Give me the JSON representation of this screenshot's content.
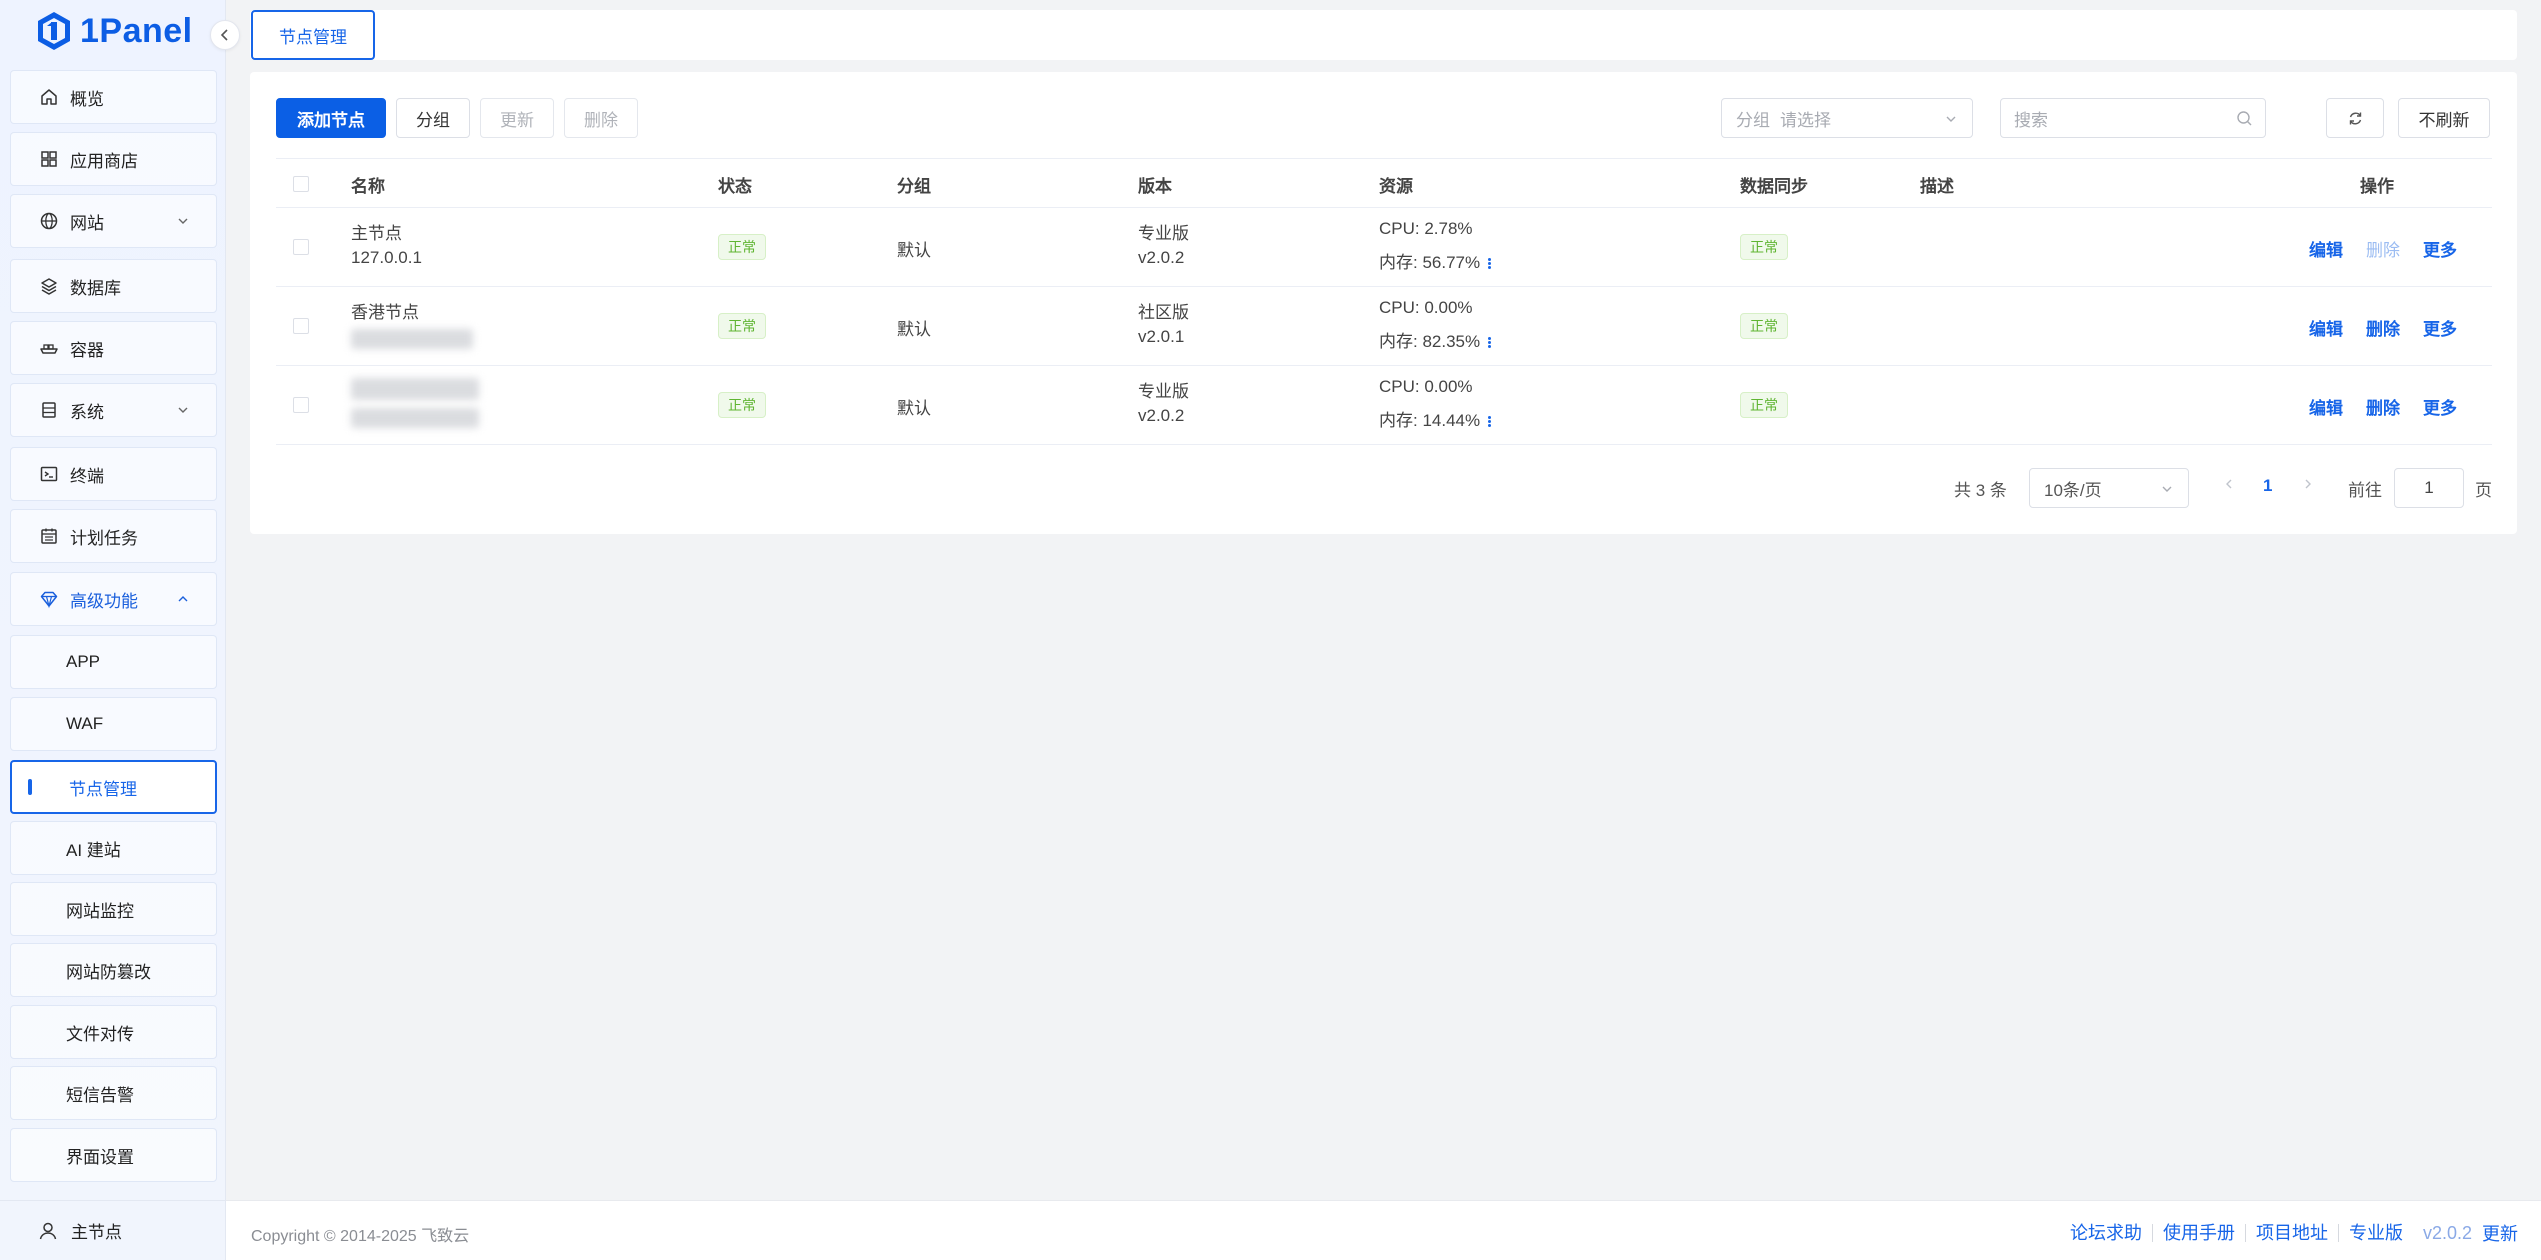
{
  "brand": {
    "name": "1Panel",
    "color": "#0c5de4"
  },
  "sidebar": {
    "items": [
      {
        "label": "概览",
        "icon": "home-icon"
      },
      {
        "label": "应用商店",
        "icon": "apps-grid-icon"
      },
      {
        "label": "网站",
        "icon": "globe-icon"
      },
      {
        "label": "数据库",
        "icon": "layers-icon"
      },
      {
        "label": "容器",
        "icon": "container-ship-icon"
      },
      {
        "label": "系统",
        "icon": "server-icon"
      },
      {
        "label": "终端",
        "icon": "terminal-icon"
      },
      {
        "label": "计划任务",
        "icon": "calendar-icon"
      },
      {
        "label": "高级功能",
        "icon": "diamond-icon"
      }
    ],
    "submenu": [
      {
        "label": "APP"
      },
      {
        "label": "WAF"
      },
      {
        "label": "节点管理"
      },
      {
        "label": "AI 建站"
      },
      {
        "label": "网站监控"
      },
      {
        "label": "网站防篡改"
      },
      {
        "label": "文件对传"
      },
      {
        "label": "短信告警"
      },
      {
        "label": "界面设置"
      }
    ],
    "footer": {
      "label": "主节点"
    }
  },
  "tabs": [
    {
      "label": "节点管理"
    }
  ],
  "toolbar": {
    "add": "添加节点",
    "group": "分组",
    "update": "更新",
    "delete": "删除",
    "group_filter_prefix": "分组",
    "group_filter_placeholder": "请选择",
    "search_placeholder": "搜索",
    "no_refresh": "不刷新"
  },
  "table": {
    "headers": {
      "name": "名称",
      "status": "状态",
      "group": "分组",
      "version": "版本",
      "resource": "资源",
      "sync": "数据同步",
      "desc": "描述",
      "actions": "操作"
    },
    "rows": [
      {
        "name": "主节点",
        "address": "127.0.0.1",
        "status": "正常",
        "group": "默认",
        "edition": "专业版",
        "version": "v2.0.2",
        "cpu": "CPU: 2.78%",
        "mem": "内存: 56.77%",
        "sync": "正常",
        "edit": "编辑",
        "delete": "删除",
        "more": "更多",
        "delete_disabled": true
      },
      {
        "name": "香港节点",
        "address": "",
        "status": "正常",
        "group": "默认",
        "edition": "社区版",
        "version": "v2.0.1",
        "cpu": "CPU: 0.00%",
        "mem": "内存: 82.35%",
        "sync": "正常",
        "edit": "编辑",
        "delete": "删除",
        "more": "更多",
        "delete_disabled": false
      },
      {
        "name": "",
        "address": "",
        "status": "正常",
        "group": "默认",
        "edition": "专业版",
        "version": "v2.0.2",
        "cpu": "CPU: 0.00%",
        "mem": "内存: 14.44%",
        "sync": "正常",
        "edit": "编辑",
        "delete": "删除",
        "more": "更多",
        "delete_disabled": false
      }
    ]
  },
  "pagination": {
    "total": "共 3 条",
    "page_size": "10条/页",
    "current": "1",
    "goto_prefix": "前往",
    "goto_value": "1",
    "goto_suffix": "页"
  },
  "footer": {
    "copyright": "Copyright © 2014-2025 飞致云",
    "links": [
      "论坛求助",
      "使用手册",
      "项目地址",
      "专业版"
    ],
    "version": "v2.0.2",
    "update": "更新"
  },
  "colors": {
    "accent": "#1765e8",
    "success": "#5fb532",
    "success_bg": "#f0f9eb"
  }
}
